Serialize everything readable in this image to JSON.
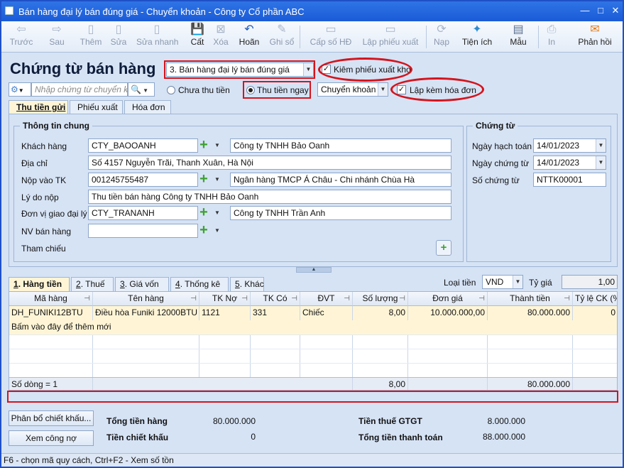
{
  "window": {
    "title": "Bán hàng đại lý bán đúng giá - Chuyển khoản - Công ty Cổ phần ABC"
  },
  "toolbar": [
    {
      "label": "Trước",
      "icon": "arrow-left-icon",
      "enabled": false
    },
    {
      "label": "Sau",
      "icon": "arrow-right-icon",
      "enabled": false
    },
    {
      "label": "Thêm",
      "icon": "add-document-icon",
      "enabled": false
    },
    {
      "label": "Sửa",
      "icon": "edit-document-icon",
      "enabled": false
    },
    {
      "label": "Sửa nhanh",
      "icon": "quick-edit-icon",
      "enabled": false
    },
    {
      "label": "Cất",
      "icon": "save-icon",
      "enabled": true
    },
    {
      "label": "Xóa",
      "icon": "delete-icon",
      "enabled": false
    },
    {
      "label": "Hoãn",
      "icon": "undo-icon",
      "enabled": true
    },
    {
      "label": "Ghi sổ",
      "icon": "pencil-icon",
      "enabled": false
    },
    {
      "label": "Cấp số HĐ",
      "icon": "invoice-number-icon",
      "enabled": false
    },
    {
      "label": "Lập phiếu xuất",
      "icon": "issue-slip-icon",
      "enabled": false
    },
    {
      "label": "Nạp",
      "icon": "reload-icon",
      "enabled": false
    },
    {
      "label": "Tiện ích",
      "icon": "tools-icon",
      "enabled": true
    },
    {
      "label": "Mẫu",
      "icon": "template-icon",
      "enabled": true
    },
    {
      "label": "In",
      "icon": "print-icon",
      "enabled": false
    },
    {
      "label": "Phản hồi",
      "icon": "feedback-mail-icon",
      "enabled": true
    }
  ],
  "header": {
    "title": "Chứng từ bán hàng",
    "type_select": "3. Bán hàng đại lý bán đúng giá",
    "check_export": "Kiêm phiếu xuất kho",
    "search_placeholder": "Nhập chứng từ chuyển kho",
    "radio_unpaid": "Chưa thu tiền",
    "radio_paid": "Thu tiền ngay",
    "payment_method": "Chuyển khoản",
    "check_invoice": "Lập kèm hóa đơn"
  },
  "tabs": [
    "Thu tiền gửi",
    "Phiếu xuất",
    "Hóa đơn"
  ],
  "general": {
    "group_title": "Thông tin chung",
    "customer_label": "Khách hàng",
    "customer_code": "CTY_BAOOANH",
    "customer_name": "Công ty TNHH Bảo Oanh",
    "address_label": "Địa chỉ",
    "address": "Số 4157 Nguyễn Trãi, Thanh Xuân, Hà Nội",
    "account_label": "Nộp vào TK",
    "account": "001245755487",
    "bank": "Ngân hàng TMCP Á Châu - Chi nhánh Chùa Hà",
    "reason_label": "Lý do nộp",
    "reason": "Thu tiền bán hàng Công ty TNHH Bảo Oanh",
    "agent_label": "Đơn vị giao đại lý",
    "agent_code": "CTY_TRANANH",
    "agent_name": "Công ty TNHH Trần Anh",
    "staff_label": "NV bán hàng",
    "staff": "",
    "ref_label": "Tham chiếu"
  },
  "voucher": {
    "group_title": "Chứng từ",
    "posting_date_label": "Ngày hạch toán",
    "posting_date": "14/01/2023",
    "voucher_date_label": "Ngày chứng từ",
    "voucher_date": "14/01/2023",
    "voucher_no_label": "Số chứng từ",
    "voucher_no": "NTTK00001"
  },
  "detail_tabs": [
    {
      "key": "1",
      "rest": ". Hàng tiền"
    },
    {
      "key": "2",
      "rest": ". Thuế"
    },
    {
      "key": "3",
      "rest": ". Giá vốn"
    },
    {
      "key": "4",
      "rest": ". Thống kê"
    },
    {
      "key": "5",
      "rest": ". Khác"
    }
  ],
  "currency": {
    "label": "Loại tiền",
    "value": "VND",
    "rate_label": "Tỷ giá",
    "rate": "1,00"
  },
  "grid": {
    "columns": [
      "Mã hàng",
      "Tên hàng",
      "TK Nợ",
      "TK Có",
      "ĐVT",
      "Số lượng",
      "Đơn giá",
      "Thành tiền",
      "Tỷ lệ CK (%"
    ],
    "rows": [
      [
        "DH_FUNIKI12BTU",
        "Điều hòa Funiki 12000BTU",
        "1121",
        "331",
        "Chiếc",
        "8,00",
        "10.000.000,00",
        "80.000.000",
        "0"
      ]
    ],
    "add_hint": "Bấm vào đây để thêm mới",
    "footer": {
      "count": "Số dòng = 1",
      "qty": "8,00",
      "amount": "80.000.000"
    }
  },
  "totals": {
    "btn_allocate": "Phân bổ chiết khấu...",
    "btn_debt": "Xem công nợ",
    "total_goods_label": "Tổng tiền hàng",
    "total_goods": "80.000.000",
    "discount_label": "Tiền chiết khấu",
    "discount": "0",
    "vat_label": "Tiền thuế GTGT",
    "vat": "8.000.000",
    "payment_label": "Tổng tiền thanh toán",
    "payment": "88.000.000"
  },
  "status": "F6 - chọn mã quy cách, Ctrl+F2 - Xem số tồn"
}
